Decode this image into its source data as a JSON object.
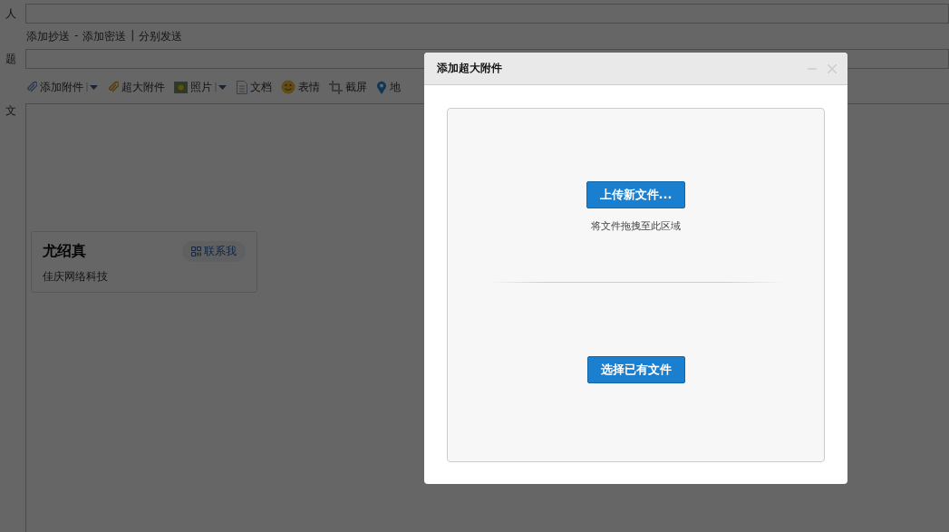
{
  "compose": {
    "to_label": "人",
    "links": [
      "添加抄送",
      "-",
      "添加密送",
      "|",
      "分别发送"
    ],
    "subject_label": "题",
    "toolbar": [
      {
        "kind": "clip",
        "label": "添加附件",
        "dropdown": true
      },
      {
        "kind": "bigclip",
        "label": "超大附件",
        "dropdown": false
      },
      {
        "kind": "photo",
        "label": "照片",
        "dropdown": true
      },
      {
        "kind": "doc",
        "label": "文档",
        "dropdown": false
      },
      {
        "kind": "smile",
        "label": "表情",
        "dropdown": false
      },
      {
        "kind": "screenshot",
        "label": "截屏",
        "dropdown": false
      },
      {
        "kind": "pin",
        "label": "地",
        "dropdown": false
      }
    ],
    "body_label": "文",
    "signature": {
      "name": "尤绍真",
      "contact_button": "联系我",
      "company": "佳庆网络科技"
    }
  },
  "dialog": {
    "title": "添加超大附件",
    "upload_button": "上传新文件...",
    "drop_hint": "将文件拖拽至此区域",
    "choose_button": "选择已有文件"
  }
}
